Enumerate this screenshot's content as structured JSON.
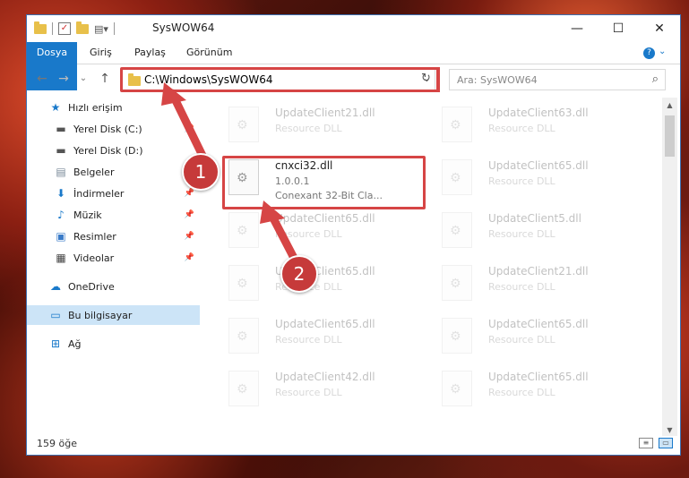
{
  "window": {
    "title": "SysWOW64",
    "minimize": "—",
    "maximize": "☐",
    "close": "✕"
  },
  "ribbon": {
    "tabs": [
      "Dosya",
      "Giriş",
      "Paylaş",
      "Görünüm"
    ],
    "help": "?",
    "expand": "⌄"
  },
  "nav": {
    "back": "←",
    "forward": "→",
    "recent": "⌄",
    "up": "↑",
    "address": "C:\\Windows\\SysWOW64",
    "address_chevron": "⌄",
    "refresh": "↻",
    "search_placeholder": "Ara: SysWOW64",
    "search_icon": "⌕"
  },
  "sidebar": {
    "items": [
      {
        "label": "Hızlı erişim",
        "icon": "star-icon",
        "glyph": "★",
        "color": "#1979ca",
        "pinned": false
      },
      {
        "label": "Yerel Disk (C:)",
        "icon": "drive-icon",
        "glyph": "▬",
        "color": "#555555",
        "pinned": true
      },
      {
        "label": "Yerel Disk (D:)",
        "icon": "drive-icon",
        "glyph": "▬",
        "color": "#555555",
        "pinned": false
      },
      {
        "label": "Belgeler",
        "icon": "documents-icon",
        "glyph": "▤",
        "color": "#7a8a99",
        "pinned": true
      },
      {
        "label": "İndirmeler",
        "icon": "download-icon",
        "glyph": "⬇",
        "color": "#1979ca",
        "pinned": true
      },
      {
        "label": "Müzik",
        "icon": "music-icon",
        "glyph": "♪",
        "color": "#1979ca",
        "pinned": true
      },
      {
        "label": "Resimler",
        "icon": "pictures-icon",
        "glyph": "▣",
        "color": "#3a7bc8",
        "pinned": true
      },
      {
        "label": "Videolar",
        "icon": "videos-icon",
        "glyph": "▦",
        "color": "#444444",
        "pinned": true
      },
      {
        "label": "OneDrive",
        "icon": "cloud-icon",
        "glyph": "☁",
        "color": "#1979ca",
        "pinned": false
      },
      {
        "label": "Bu bilgisayar",
        "icon": "computer-icon",
        "glyph": "▭",
        "color": "#1979ca",
        "pinned": false,
        "selected": true
      },
      {
        "label": "Ağ",
        "icon": "network-icon",
        "glyph": "⊞",
        "color": "#1979ca",
        "pinned": false
      }
    ],
    "pin_glyph": "📌"
  },
  "files": [
    {
      "name": "UpdateClient21.dll",
      "desc": "Resource DLL",
      "faded": true
    },
    {
      "name": "UpdateClient63.dll",
      "desc": "Resource DLL",
      "faded": true
    },
    {
      "name": "cnxci32.dll",
      "desc": "1.0.0.1",
      "desc2": "Conexant 32-Bit Cla...",
      "faded": false
    },
    {
      "name": "UpdateClient65.dll",
      "desc": "Resource DLL",
      "faded": true
    },
    {
      "name": "UpdateClient65.dll",
      "desc": "Resource DLL",
      "faded": true
    },
    {
      "name": "UpdateClient5.dll",
      "desc": "Resource DLL",
      "faded": true
    },
    {
      "name": "UpdateClient65.dll",
      "desc": "Resource DLL",
      "faded": true
    },
    {
      "name": "UpdateClient21.dll",
      "desc": "Resource DLL",
      "faded": true
    },
    {
      "name": "UpdateClient65.dll",
      "desc": "Resource DLL",
      "faded": true
    },
    {
      "name": "UpdateClient65.dll",
      "desc": "Resource DLL",
      "faded": true
    },
    {
      "name": "UpdateClient42.dll",
      "desc": "Resource DLL",
      "faded": true
    },
    {
      "name": "UpdateClient65.dll",
      "desc": "Resource DLL",
      "faded": true
    }
  ],
  "status": {
    "count": "159 öğe"
  },
  "annotations": {
    "badge1": "1",
    "badge2": "2",
    "highlight_color": "#d64545"
  }
}
